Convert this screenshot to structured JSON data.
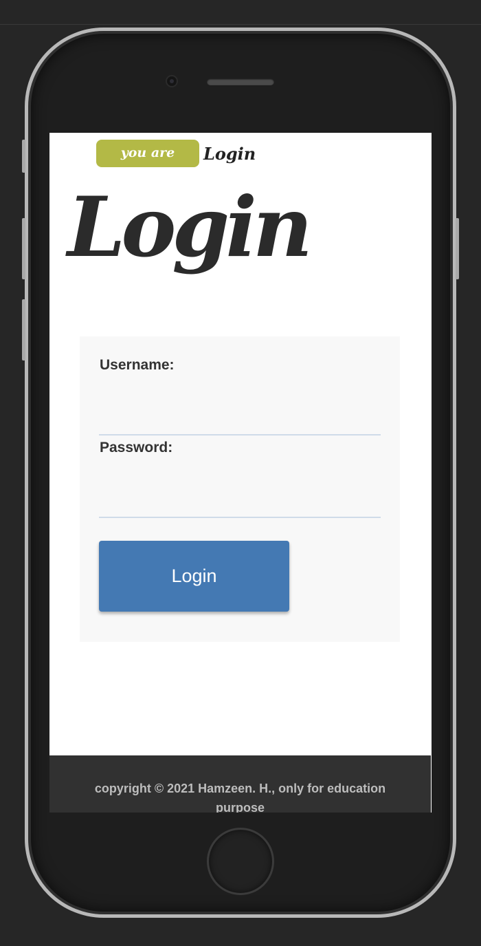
{
  "breadcrumb": {
    "badge": "you are here",
    "current": "Login"
  },
  "page": {
    "title": "Login"
  },
  "form": {
    "username_label": "Username:",
    "username_value": "",
    "password_label": "Password:",
    "password_value": "",
    "login_button": "Login"
  },
  "footer": {
    "text": "copyright © 2021 Hamzeen. H., only for education purpose"
  },
  "colors": {
    "badge": "#b3b946",
    "button": "#4479b3",
    "footer_bg": "#313131",
    "page_bg": "#262626"
  },
  "icons": {
    "camera": "front-camera-icon",
    "speaker": "earpiece-speaker-icon",
    "home": "home-button-icon"
  }
}
